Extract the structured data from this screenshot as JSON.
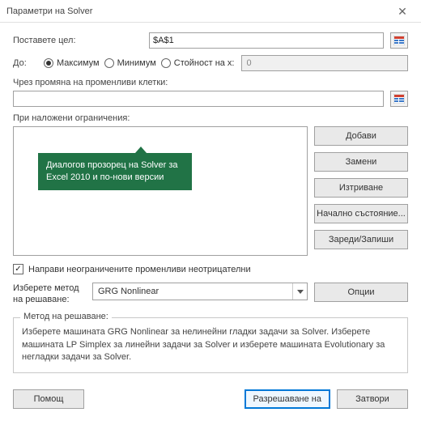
{
  "title": "Параметри на Solver",
  "objective": {
    "label": "Поставете цел:",
    "value": "$A$1",
    "to_label": "До:",
    "radios": {
      "max": "Максимум",
      "min": "Минимум",
      "value_of": "Стойност на х:"
    },
    "value_of_value": "0"
  },
  "changing": {
    "label": "Чрез промяна на променливи клетки:",
    "value": ""
  },
  "constraints": {
    "label": "При наложени ограничения:"
  },
  "callout": "Диалогов прозорец на Solver за Excel 2010 и по-нови версии",
  "buttons": {
    "add": "Добави",
    "change": "Замени",
    "delete": "Изтриване",
    "reset": "Начално състояние...",
    "loadsave": "Зареди/Запиши",
    "options": "Опции",
    "help": "Помощ",
    "solve": "Разрешаване на",
    "close": "Затвори"
  },
  "checkbox": {
    "label": "Направи неограничените променливи неотрицателни",
    "checked": true
  },
  "method": {
    "label": "Изберете метод на решаване:",
    "value": "GRG Nonlinear"
  },
  "method_group": {
    "title": "Метод на решаване:",
    "body": "Изберете машината GRG Nonlinear за нелинейни гладки задачи за Solver. Изберете машината LP Simplex за линейни задачи за Solver и изберете машината Evolutionary за негладки задачи за Solver."
  }
}
